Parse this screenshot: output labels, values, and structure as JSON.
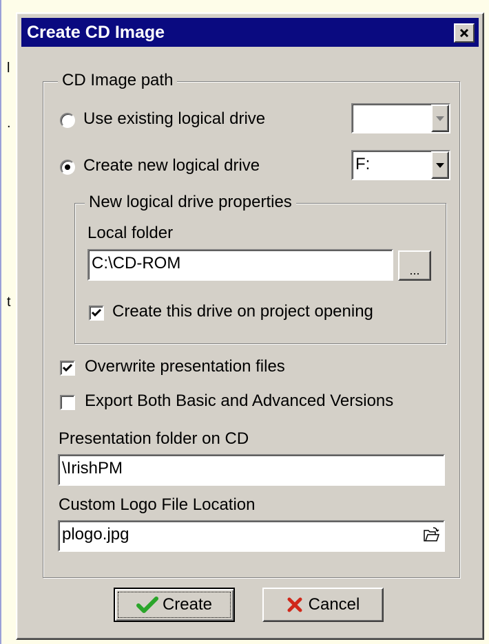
{
  "dialog": {
    "title": "Create CD Image",
    "close_label": "×"
  },
  "background_fragments": [
    "l",
    ".",
    "t"
  ],
  "cd_image_path": {
    "group_label": "CD Image path",
    "use_existing": {
      "label": "Use existing logical drive",
      "selected": false,
      "drive_value": ""
    },
    "create_new": {
      "label": "Create new logical drive",
      "selected": true,
      "drive_value": "F:"
    }
  },
  "new_drive_props": {
    "group_label": "New logical drive properties",
    "local_folder_label": "Local folder",
    "local_folder_value": "C:\\CD-ROM",
    "browse_label": "...",
    "create_on_open_label": "Create this drive on project opening",
    "create_on_open_checked": true
  },
  "options": {
    "overwrite_label": "Overwrite presentation files",
    "overwrite_checked": true,
    "export_both_label": "Export Both Basic and Advanced Versions",
    "export_both_checked": false
  },
  "presentation_folder": {
    "label": "Presentation folder on CD",
    "value": "\\IrishPM"
  },
  "custom_logo": {
    "label": "Custom Logo File Location",
    "value": "plogo.jpg"
  },
  "buttons": {
    "create_label": "Create",
    "cancel_label": "Cancel"
  },
  "colors": {
    "titlebar": "#0a0a80",
    "face": "#d4d0c8",
    "page_bg": "#fefde9",
    "create_check": "#2aa52a",
    "cancel_x": "#d0281a"
  }
}
